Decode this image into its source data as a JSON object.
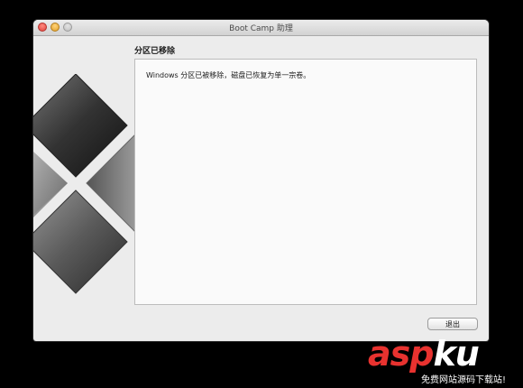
{
  "window": {
    "title": "Boot Camp 助理"
  },
  "main": {
    "heading": "分区已移除",
    "message": "Windows 分区已被移除，磁盘已恢复为单一宗卷。"
  },
  "footer": {
    "exit_label": "退出"
  },
  "watermark": {
    "brand_asp": "asp",
    "brand_ku": "ku",
    "tagline": "免费网站源码下载站!"
  },
  "colors": {
    "watermark_red": "#e8322f",
    "window_bg": "#ececec",
    "content_bg": "#fafafa"
  },
  "icons": {
    "logo": "boot-camp-logo-icon",
    "close": "close-icon",
    "minimize": "minimize-icon",
    "zoom": "zoom-icon"
  }
}
